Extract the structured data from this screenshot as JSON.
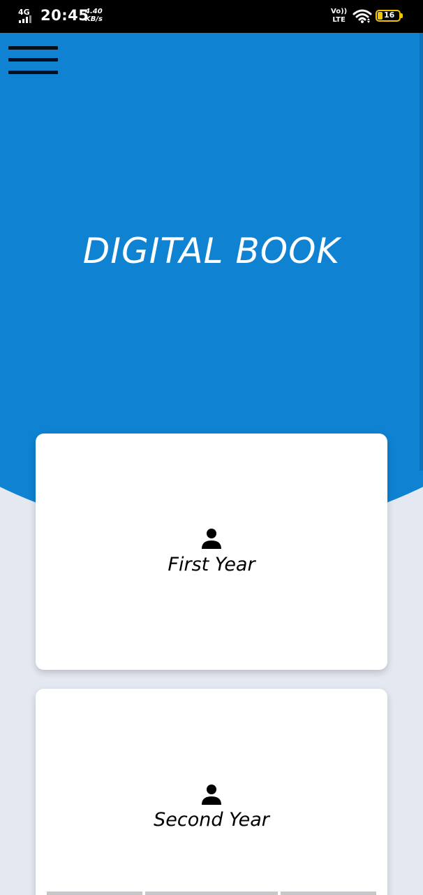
{
  "status_bar": {
    "network": "4G",
    "time": "20:45",
    "speed_value": "4.40",
    "speed_unit": "KB/s",
    "volte": "Vo))",
    "lte": "LTE",
    "battery": "16"
  },
  "header": {
    "title": "DIGITAL BOOK",
    "menu_icon": "hamburger-menu-icon",
    "background_color": "#0f82d2"
  },
  "cards": [
    {
      "icon": "person-icon",
      "label": "First Year"
    },
    {
      "icon": "person-icon",
      "label": "Second Year"
    }
  ]
}
